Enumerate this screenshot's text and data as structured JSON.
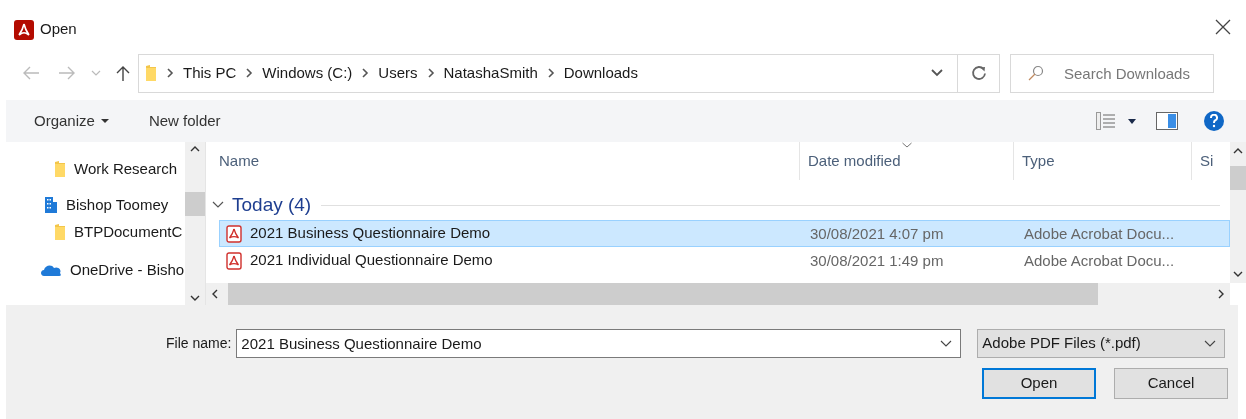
{
  "window": {
    "title": "Open"
  },
  "address_bar": {
    "path": [
      "This PC",
      "Windows (C:)",
      "Users",
      "NatashaSmith",
      "Downloads"
    ]
  },
  "search": {
    "placeholder": "Search Downloads"
  },
  "toolbar": {
    "organize": "Organize",
    "new_folder": "New folder"
  },
  "sidebar": {
    "items": [
      {
        "label": "Work Research",
        "kind": "folder"
      },
      {
        "label": "Bishop Toomey",
        "kind": "site"
      },
      {
        "label": "BTPDocumentC",
        "kind": "folder"
      },
      {
        "label": "OneDrive - Bisho",
        "kind": "cloud"
      }
    ]
  },
  "table": {
    "columns": [
      {
        "label": "Name",
        "sorted": false
      },
      {
        "label": "Date modified",
        "sorted": true
      },
      {
        "label": "Type",
        "sorted": false
      },
      {
        "label": "Si",
        "sorted": false
      }
    ],
    "groups": [
      {
        "label": "Today (4)",
        "expanded": true,
        "rows": [
          {
            "name": "2021 Business Questionnaire Demo",
            "date": "30/08/2021 4:07 pm",
            "type": "Adobe Acrobat Docu...",
            "selected": true
          },
          {
            "name": "2021 Individual Questionnaire Demo",
            "date": "30/08/2021 1:49 pm",
            "type": "Adobe Acrobat Docu...",
            "selected": false
          }
        ]
      }
    ]
  },
  "file_name": {
    "label": "File name:",
    "value": "2021 Business Questionnaire Demo"
  },
  "file_type": {
    "value": "Adobe PDF Files (*.pdf)"
  },
  "buttons": [
    {
      "label": "Open",
      "default": true
    },
    {
      "label": "Cancel",
      "default": false
    }
  ]
}
